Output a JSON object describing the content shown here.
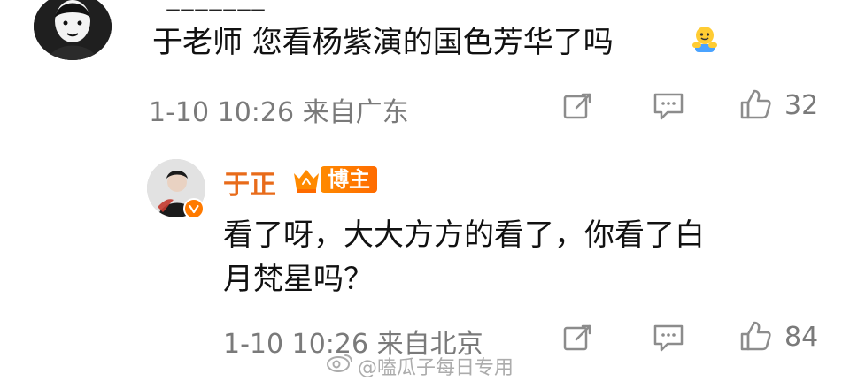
{
  "comment": {
    "username_partial": "“_______”",
    "text": "于老师 您看杨紫演的国色芳华了吗",
    "emoji": "hug-emoji",
    "meta": "1-10 10:26 来自广东",
    "likes": "32"
  },
  "reply": {
    "author": "于正",
    "badge": "博主",
    "text_line1": "看了呀，大大方方的看了，你看了白",
    "text_line2": "月梵星吗？",
    "meta": "1-10 10:26 来自北京",
    "likes": "84"
  },
  "watermark": {
    "text": "@嗑瓜子每日专用"
  },
  "colors": {
    "meta_gray": "#7a7a7a",
    "reply_name": "#e86b1a",
    "badge_bg": "#ff7a00"
  }
}
